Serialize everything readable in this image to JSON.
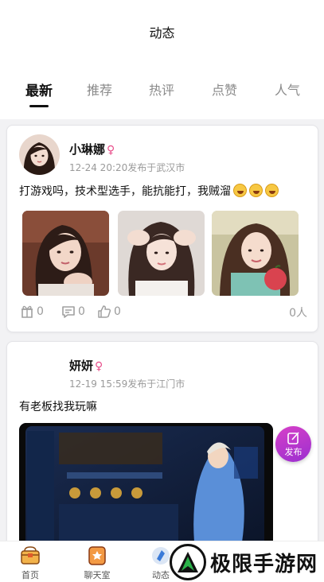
{
  "header": {
    "title": "动态"
  },
  "tabs": [
    {
      "label": "最新",
      "active": true
    },
    {
      "label": "推荐"
    },
    {
      "label": "热评"
    },
    {
      "label": "点赞"
    },
    {
      "label": "人气"
    }
  ],
  "posts": [
    {
      "username": "小琳娜",
      "gender": "♀",
      "meta": "12-24 20:20发布于武汉市",
      "text": "打游戏吗，技术型选手，能抗能打，我贼溜",
      "emojis": [
        "grin-icon",
        "grin-icon",
        "grin-icon"
      ],
      "photo_count": 3,
      "gifts": "0",
      "comments": "0",
      "likes": "0",
      "people": "0人"
    },
    {
      "username": "妍妍",
      "gender": "♀",
      "meta": "12-19 15:59发布于江门市",
      "text": "有老板找我玩嘛"
    }
  ],
  "publish_button": {
    "label": "发布"
  },
  "bottom_nav": [
    {
      "label": "首页",
      "icon": "treasure-chest-icon"
    },
    {
      "label": "聊天室",
      "icon": "chat-room-icon"
    },
    {
      "label": "动态",
      "icon": "moments-icon"
    }
  ],
  "watermark": {
    "text": "极限手游网"
  },
  "colors": {
    "accent": "#c43bcc",
    "gender": "#e84d8a",
    "muted": "#9a9a9a"
  }
}
